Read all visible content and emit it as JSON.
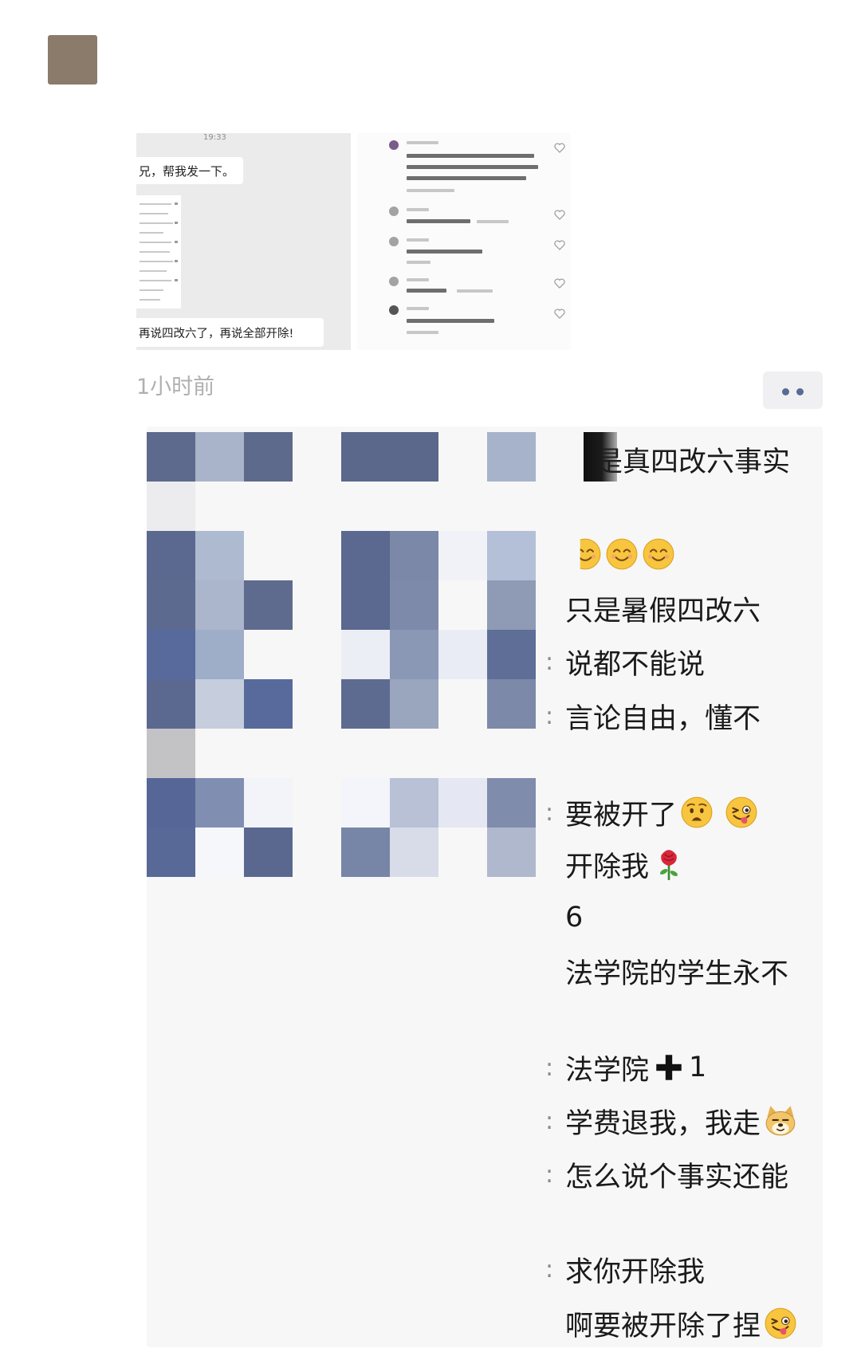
{
  "post": {
    "chat_image": {
      "time": "19:33",
      "message_top": "兄，帮我发一下。",
      "message_bottom": "再说四改六了，再说全部开除!"
    },
    "timestamp": "1小时前",
    "more_icon": "more-dots-icon"
  },
  "comments": [
    {
      "text": "是真四改六事实"
    },
    {
      "text": "",
      "emoji": [
        "smiling-face",
        "smiling-face",
        "smiling-face"
      ]
    },
    {
      "text": "只是暑假四改六"
    },
    {
      "separator": ":",
      "text": "说都不能说"
    },
    {
      "separator": ":",
      "text": "言论自由，懂不"
    },
    {
      "separator": ":",
      "text": "要被开了",
      "emoji": [
        "worried-face",
        "winking-tongue-face"
      ]
    },
    {
      "text": "开除我",
      "emoji": [
        "rose"
      ]
    },
    {
      "text": "6"
    },
    {
      "text": "法学院的学生永不"
    },
    {
      "separator": ":",
      "text": "法学院",
      "emoji": [
        "heavy-plus"
      ],
      "suffix": "1"
    },
    {
      "separator": ":",
      "text": "学费退我，我走",
      "emoji": [
        "doge"
      ]
    },
    {
      "separator": ":",
      "text": "怎么说个事实还能"
    },
    {
      "separator": ":",
      "text": "求你开除我"
    },
    {
      "text": "啊要被开除了捏",
      "emoji": [
        "winking-tongue-face"
      ]
    }
  ],
  "colors": {
    "avatar": "#8a7b6b",
    "comment_bg": "#f7f7f7",
    "link_blue": "#576b95",
    "timestamp": "#b0b0b0"
  }
}
